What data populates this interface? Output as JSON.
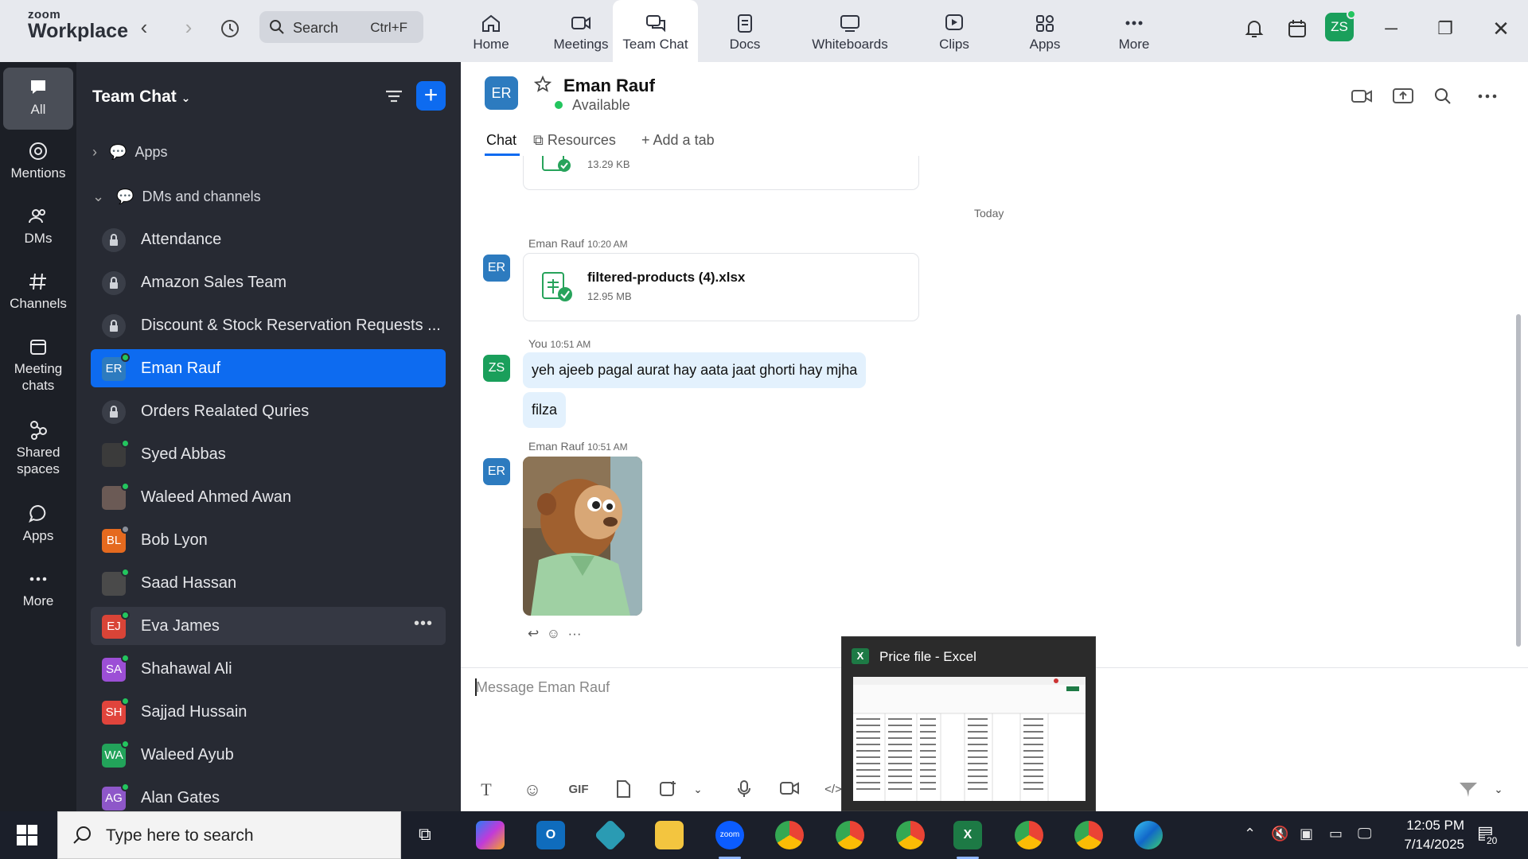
{
  "app": {
    "brand_top": "zoom",
    "brand_bottom": "Workplace"
  },
  "topbar": {
    "search_label": "Search",
    "search_shortcut": "Ctrl+F",
    "tabs": [
      {
        "label": "Home",
        "icon": "home-icon"
      },
      {
        "label": "Meetings",
        "icon": "video-camera-icon"
      },
      {
        "label": "Team Chat",
        "icon": "chat-bubbles-icon",
        "active": true
      },
      {
        "label": "Docs",
        "icon": "document-icon"
      },
      {
        "label": "Whiteboards",
        "icon": "whiteboard-icon"
      },
      {
        "label": "Clips",
        "icon": "clip-play-icon"
      },
      {
        "label": "Apps",
        "icon": "apps-grid-icon"
      },
      {
        "label": "More",
        "icon": "more-dots-icon"
      }
    ],
    "profile_initials": "ZS"
  },
  "rail": {
    "items": [
      {
        "label": "All"
      },
      {
        "label": "Mentions"
      },
      {
        "label": "DMs"
      },
      {
        "label": "Channels"
      },
      {
        "label_line1": "Meeting",
        "label_line2": "chats"
      },
      {
        "label_line1": "Shared",
        "label_line2": "spaces"
      },
      {
        "label": "Apps"
      },
      {
        "label": "More"
      }
    ]
  },
  "sidebar": {
    "title": "Team Chat",
    "sections": {
      "apps": "Apps",
      "dms": "DMs and channels"
    },
    "channels": [
      {
        "name": "Attendance",
        "type": "lock"
      },
      {
        "name": "Amazon Sales Team",
        "type": "lock"
      },
      {
        "name": "Discount & Stock Reservation Requests ...",
        "type": "lock"
      },
      {
        "name": "Eman Rauf",
        "type": "avatar",
        "initials": "ER",
        "color": "#2d7bbf"
      },
      {
        "name": "Orders Realated Quries",
        "type": "lock"
      },
      {
        "name": "Syed Abbas",
        "type": "photo",
        "color": "#3b3b3b"
      },
      {
        "name": "Waleed Ahmed Awan",
        "type": "photo",
        "color": "#6b5a55"
      },
      {
        "name": "Bob Lyon",
        "type": "avatar",
        "initials": "BL",
        "color": "#e56a1f"
      },
      {
        "name": "Saad Hassan",
        "type": "photo",
        "color": "#4a4a4a"
      },
      {
        "name": "Eva James",
        "type": "avatar",
        "initials": "EJ",
        "color": "#d94437"
      },
      {
        "name": "Shahawal Ali",
        "type": "avatar",
        "initials": "SA",
        "color": "#9c4fd6"
      },
      {
        "name": "Sajjad Hussain",
        "type": "avatar",
        "initials": "SH",
        "color": "#e0443c"
      },
      {
        "name": "Waleed Ayub",
        "type": "avatar",
        "initials": "WA",
        "color": "#22a35a"
      },
      {
        "name": "Alan Gates",
        "type": "avatar",
        "initials": "AG",
        "color": "#8e57c9"
      }
    ]
  },
  "chat": {
    "contact_name": "Eman Rauf",
    "contact_initials": "ER",
    "status": "Available",
    "tabs": {
      "chat": "Chat",
      "resources": "Resources",
      "add": "Add a tab"
    },
    "prev_file_size": "13.29 KB",
    "day_divider": "Today",
    "messages": [
      {
        "sender": "Eman Rauf",
        "time": "10:20 AM",
        "file_name": "filtered-products (4).xlsx",
        "file_size": "12.95 MB"
      },
      {
        "sender": "You",
        "time": "10:51 AM",
        "text1": "yeh ajeeb pagal aurat hay aata jaat ghorti hay mjha",
        "text2": "filza"
      },
      {
        "sender": "Eman Rauf",
        "time": "10:51 AM",
        "image": "puppet-meme-image"
      }
    ],
    "composer_placeholder": "Message Eman Rauf",
    "gif_label": "GIF"
  },
  "popup": {
    "title": "Price file - Excel",
    "badge": "X"
  },
  "taskbar": {
    "search_placeholder": "Type here to search",
    "time": "12:05 PM",
    "date": "7/14/2025",
    "notification_count": "20"
  },
  "colors": {
    "accent": "#0d6bf0",
    "sidebar_bg": "#272a33",
    "rail_bg": "#1c1f26",
    "online": "#23c55e"
  }
}
